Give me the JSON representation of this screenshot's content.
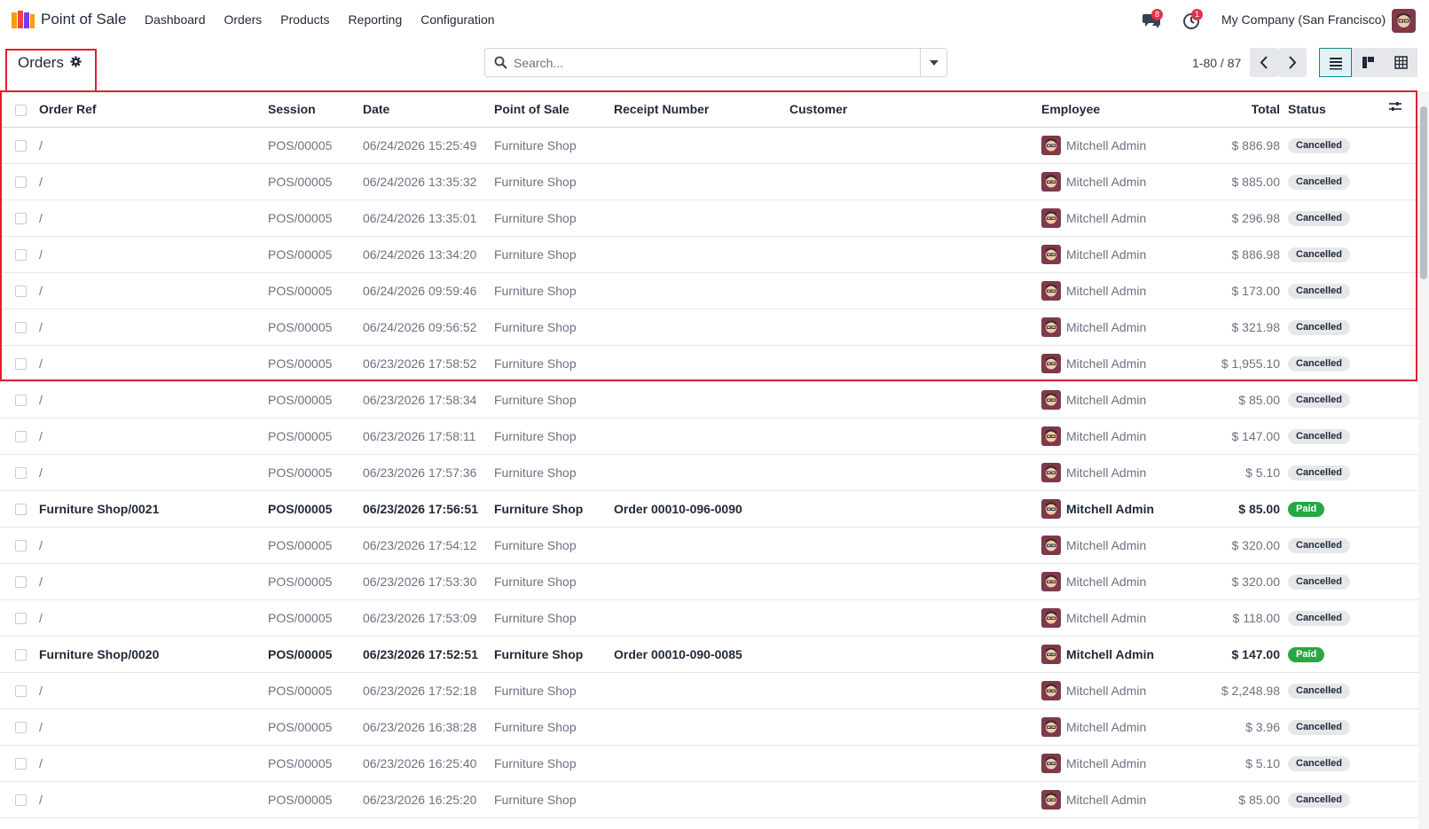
{
  "app": {
    "name": "Point of Sale",
    "brand_color": "#e4334a"
  },
  "menu": [
    "Dashboard",
    "Orders",
    "Products",
    "Reporting",
    "Configuration"
  ],
  "systray": {
    "messages_count": "8",
    "activities_count": "1",
    "company": "My Company (San Francisco)"
  },
  "page": {
    "title": "Orders"
  },
  "search": {
    "placeholder": "Search..."
  },
  "pager": {
    "value": "1-80 / 87"
  },
  "table": {
    "columns": [
      "Order Ref",
      "Session",
      "Date",
      "Point of Sale",
      "Receipt Number",
      "Customer",
      "Employee",
      "Total",
      "Status"
    ],
    "rows": [
      {
        "ref": "/",
        "session": "POS/00005",
        "date": "06/24/2026 15:25:49",
        "pos": "Furniture Shop",
        "receipt": "",
        "customer": "",
        "employee": "Mitchell Admin",
        "total": "$ 886.98",
        "status": "Cancelled"
      },
      {
        "ref": "/",
        "session": "POS/00005",
        "date": "06/24/2026 13:35:32",
        "pos": "Furniture Shop",
        "receipt": "",
        "customer": "",
        "employee": "Mitchell Admin",
        "total": "$ 885.00",
        "status": "Cancelled"
      },
      {
        "ref": "/",
        "session": "POS/00005",
        "date": "06/24/2026 13:35:01",
        "pos": "Furniture Shop",
        "receipt": "",
        "customer": "",
        "employee": "Mitchell Admin",
        "total": "$ 296.98",
        "status": "Cancelled"
      },
      {
        "ref": "/",
        "session": "POS/00005",
        "date": "06/24/2026 13:34:20",
        "pos": "Furniture Shop",
        "receipt": "",
        "customer": "",
        "employee": "Mitchell Admin",
        "total": "$ 886.98",
        "status": "Cancelled"
      },
      {
        "ref": "/",
        "session": "POS/00005",
        "date": "06/24/2026 09:59:46",
        "pos": "Furniture Shop",
        "receipt": "",
        "customer": "",
        "employee": "Mitchell Admin",
        "total": "$ 173.00",
        "status": "Cancelled"
      },
      {
        "ref": "/",
        "session": "POS/00005",
        "date": "06/24/2026 09:56:52",
        "pos": "Furniture Shop",
        "receipt": "",
        "customer": "",
        "employee": "Mitchell Admin",
        "total": "$ 321.98",
        "status": "Cancelled"
      },
      {
        "ref": "/",
        "session": "POS/00005",
        "date": "06/23/2026 17:58:52",
        "pos": "Furniture Shop",
        "receipt": "",
        "customer": "",
        "employee": "Mitchell Admin",
        "total": "$ 1,955.10",
        "status": "Cancelled"
      },
      {
        "ref": "/",
        "session": "POS/00005",
        "date": "06/23/2026 17:58:34",
        "pos": "Furniture Shop",
        "receipt": "",
        "customer": "",
        "employee": "Mitchell Admin",
        "total": "$ 85.00",
        "status": "Cancelled"
      },
      {
        "ref": "/",
        "session": "POS/00005",
        "date": "06/23/2026 17:58:11",
        "pos": "Furniture Shop",
        "receipt": "",
        "customer": "",
        "employee": "Mitchell Admin",
        "total": "$ 147.00",
        "status": "Cancelled"
      },
      {
        "ref": "/",
        "session": "POS/00005",
        "date": "06/23/2026 17:57:36",
        "pos": "Furniture Shop",
        "receipt": "",
        "customer": "",
        "employee": "Mitchell Admin",
        "total": "$ 5.10",
        "status": "Cancelled"
      },
      {
        "ref": "Furniture Shop/0021",
        "session": "POS/00005",
        "date": "06/23/2026 17:56:51",
        "pos": "Furniture Shop",
        "receipt": "Order 00010-096-0090",
        "customer": "",
        "employee": "Mitchell Admin",
        "total": "$ 85.00",
        "status": "Paid"
      },
      {
        "ref": "/",
        "session": "POS/00005",
        "date": "06/23/2026 17:54:12",
        "pos": "Furniture Shop",
        "receipt": "",
        "customer": "",
        "employee": "Mitchell Admin",
        "total": "$ 320.00",
        "status": "Cancelled"
      },
      {
        "ref": "/",
        "session": "POS/00005",
        "date": "06/23/2026 17:53:30",
        "pos": "Furniture Shop",
        "receipt": "",
        "customer": "",
        "employee": "Mitchell Admin",
        "total": "$ 320.00",
        "status": "Cancelled"
      },
      {
        "ref": "/",
        "session": "POS/00005",
        "date": "06/23/2026 17:53:09",
        "pos": "Furniture Shop",
        "receipt": "",
        "customer": "",
        "employee": "Mitchell Admin",
        "total": "$ 118.00",
        "status": "Cancelled"
      },
      {
        "ref": "Furniture Shop/0020",
        "session": "POS/00005",
        "date": "06/23/2026 17:52:51",
        "pos": "Furniture Shop",
        "receipt": "Order 00010-090-0085",
        "customer": "",
        "employee": "Mitchell Admin",
        "total": "$ 147.00",
        "status": "Paid"
      },
      {
        "ref": "/",
        "session": "POS/00005",
        "date": "06/23/2026 17:52:18",
        "pos": "Furniture Shop",
        "receipt": "",
        "customer": "",
        "employee": "Mitchell Admin",
        "total": "$ 2,248.98",
        "status": "Cancelled"
      },
      {
        "ref": "/",
        "session": "POS/00005",
        "date": "06/23/2026 16:38:28",
        "pos": "Furniture Shop",
        "receipt": "",
        "customer": "",
        "employee": "Mitchell Admin",
        "total": "$ 3.96",
        "status": "Cancelled"
      },
      {
        "ref": "/",
        "session": "POS/00005",
        "date": "06/23/2026 16:25:40",
        "pos": "Furniture Shop",
        "receipt": "",
        "customer": "",
        "employee": "Mitchell Admin",
        "total": "$ 5.10",
        "status": "Cancelled"
      },
      {
        "ref": "/",
        "session": "POS/00005",
        "date": "06/23/2026 16:25:20",
        "pos": "Furniture Shop",
        "receipt": "",
        "customer": "",
        "employee": "Mitchell Admin",
        "total": "$ 85.00",
        "status": "Cancelled"
      }
    ]
  },
  "colors": {
    "paid": "#28a745",
    "cancelled": "#e5e7eb",
    "highlight": "#e11d2e",
    "active_view": "#0f8a8a"
  },
  "icons": [
    "app-logo-icon",
    "chat-icon",
    "clock-icon",
    "gear-icon",
    "search-icon",
    "caret-down-icon",
    "chevron-left-icon",
    "chevron-right-icon",
    "list-view-icon",
    "kanban-view-icon",
    "pivot-view-icon",
    "column-settings-icon"
  ]
}
